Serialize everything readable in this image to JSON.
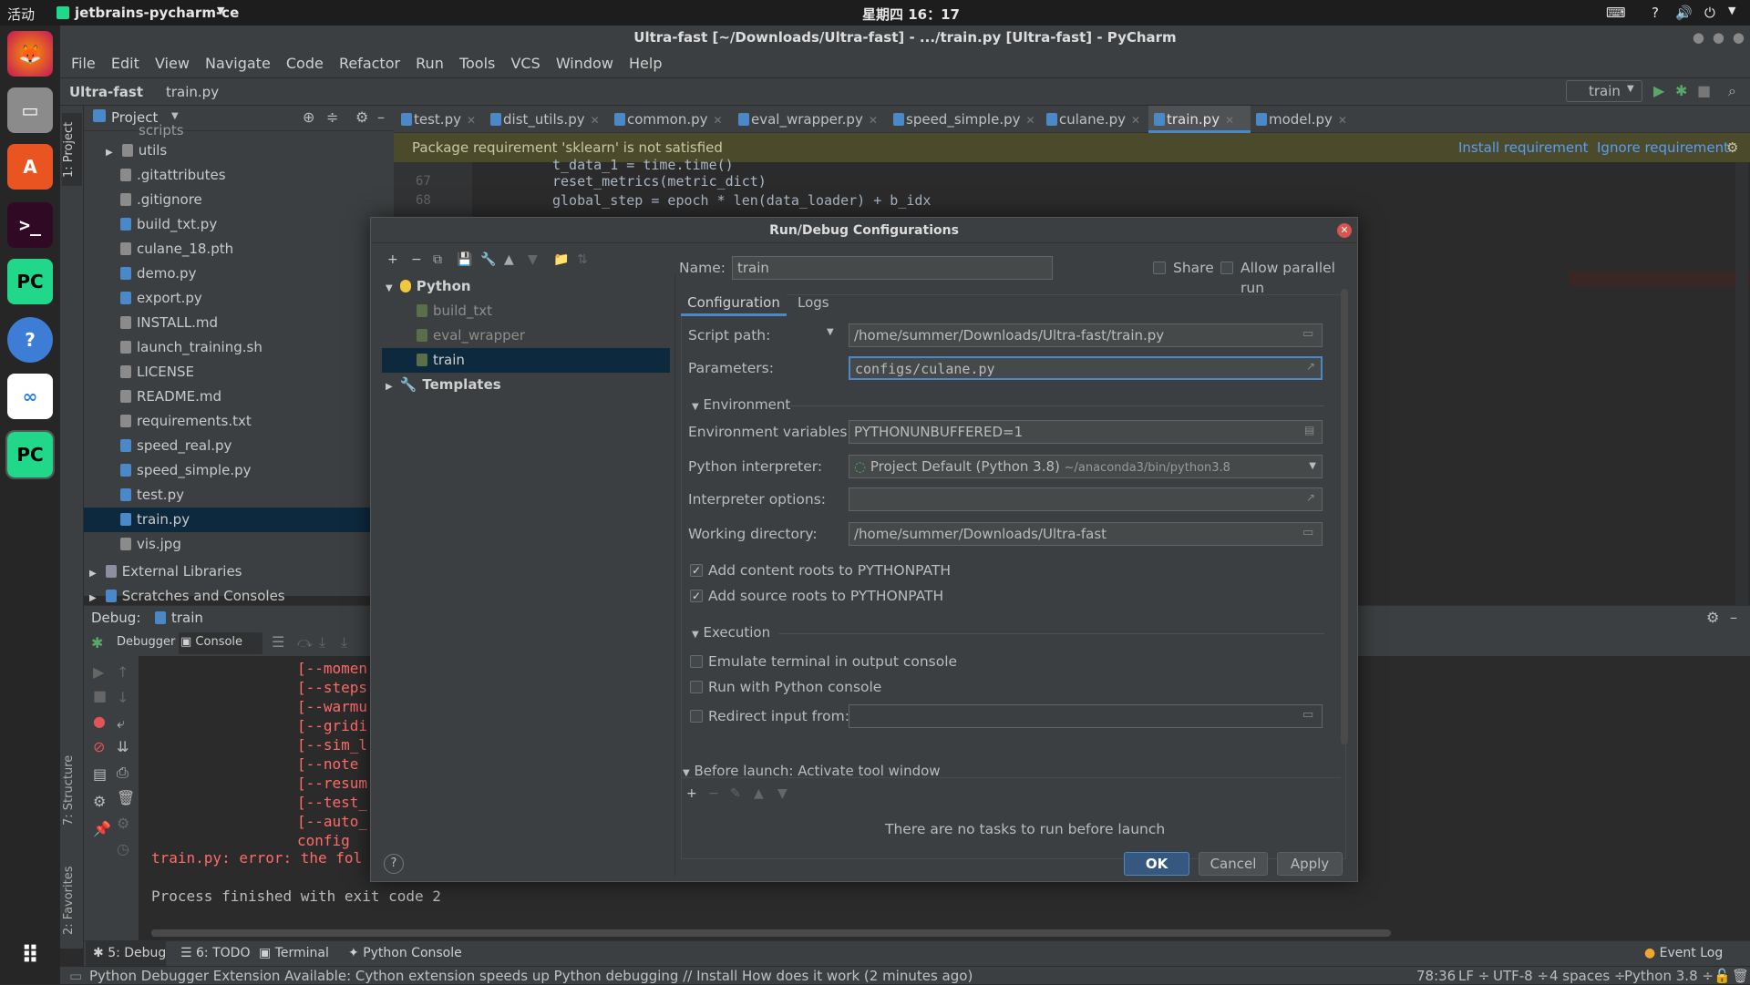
{
  "system": {
    "activities": "活动",
    "app_name": "jetbrains-pycharm-ce",
    "clock": "星期四 16：17"
  },
  "window": {
    "title": "Ultra-fast [~/Downloads/Ultra-fast] - .../train.py [Ultra-fast] - PyCharm"
  },
  "menu": [
    "File",
    "Edit",
    "View",
    "Navigate",
    "Code",
    "Refactor",
    "Run",
    "Tools",
    "VCS",
    "Window",
    "Help"
  ],
  "breadcrumb": {
    "project": "Ultra-fast",
    "file": "train.py"
  },
  "run_config_selector": "train",
  "project_panel": {
    "title": "Project",
    "scripts_label": "scripts",
    "utils_label": "utils",
    "files": [
      ".gitattributes",
      ".gitignore",
      "build_txt.py",
      "culane_18.pth",
      "demo.py",
      "export.py",
      "INSTALL.md",
      "launch_training.sh",
      "LICENSE",
      "README.md",
      "requirements.txt",
      "speed_real.py",
      "speed_simple.py",
      "test.py",
      "train.py",
      "vis.jpg"
    ],
    "external_libraries": "External Libraries",
    "scratches": "Scratches and Consoles"
  },
  "tabs": [
    "test.py",
    "dist_utils.py",
    "common.py",
    "eval_wrapper.py",
    "speed_simple.py",
    "culane.py",
    "train.py",
    "model.py"
  ],
  "banner": {
    "message": "Package requirement 'sklearn' is not satisfied",
    "install": "Install requirement",
    "ignore": "Ignore requirement"
  },
  "code_lines": [
    {
      "num": "67",
      "text": "reset_metrics(metric_dict)"
    },
    {
      "num": "68",
      "text": "global_step = epoch * len(data_loader) + b_idx"
    }
  ],
  "code_partial": "t_data_1 = time.time()",
  "debug": {
    "label": "Debug:",
    "config": "train",
    "debugger_tab": "Debugger",
    "console_tab": "Console"
  },
  "console_lines": [
    "[--momen",
    "[--steps",
    "[--warmu",
    "[--gridi",
    "[--sim_l",
    "[--note",
    "[--resum",
    "[--test_",
    "[--auto_",
    "config"
  ],
  "console_error": "train.py: error: the fol",
  "console_exit": "Process finished with exit code 2",
  "side_labels": {
    "project": "1: Project",
    "structure": "7: Structure",
    "favorites": "2: Favorites"
  },
  "bottom_tabs": [
    "5: Debug",
    "6: TODO",
    "Terminal",
    "Python Console"
  ],
  "event_log": "Event Log",
  "status": {
    "message": "Python Debugger Extension Available: Cython extension speeds up Python debugging // Install How does it work (2 minutes ago)",
    "position": "78:36",
    "line_sep": "LF ÷",
    "encoding": "UTF-8 ÷",
    "indent": "4 spaces ÷",
    "interpreter": "Python 3.8 ÷"
  },
  "dialog": {
    "title": "Run/Debug Configurations",
    "tree": {
      "python": "Python",
      "items": [
        "build_txt",
        "eval_wrapper",
        "train"
      ],
      "templates": "Templates"
    },
    "name_label": "Name:",
    "name_value": "train",
    "share": "Share",
    "allow_parallel": "Allow parallel run",
    "tabs": [
      "Configuration",
      "Logs"
    ],
    "script_path_label": "Script path:",
    "script_path": "/home/summer/Downloads/Ultra-fast/train.py",
    "parameters_label": "Parameters:",
    "parameters": "configs/culane.py",
    "environment_section": "Environment",
    "env_vars_label": "Environment variables:",
    "env_vars": "PYTHONUNBUFFERED=1",
    "interpreter_label": "Python interpreter:",
    "interpreter": "Project Default (Python 3.8)",
    "interpreter_path": "~/anaconda3/bin/python3.8",
    "interp_options_label": "Interpreter options:",
    "workdir_label": "Working directory:",
    "workdir": "/home/summer/Downloads/Ultra-fast",
    "content_roots": "Add content roots to PYTHONPATH",
    "source_roots": "Add source roots to PYTHONPATH",
    "execution_section": "Execution",
    "emulate_terminal": "Emulate terminal in output console",
    "python_console": "Run with Python console",
    "redirect_input": "Redirect input from:",
    "before_launch": "Before launch: Activate tool window",
    "no_tasks": "There are no tasks to run before launch",
    "ok": "OK",
    "cancel": "Cancel",
    "apply": "Apply"
  },
  "colors": {
    "accent": "#4a88c7",
    "selection": "#0d293e",
    "banner": "#4b4b2b",
    "error": "#ff6b68"
  }
}
